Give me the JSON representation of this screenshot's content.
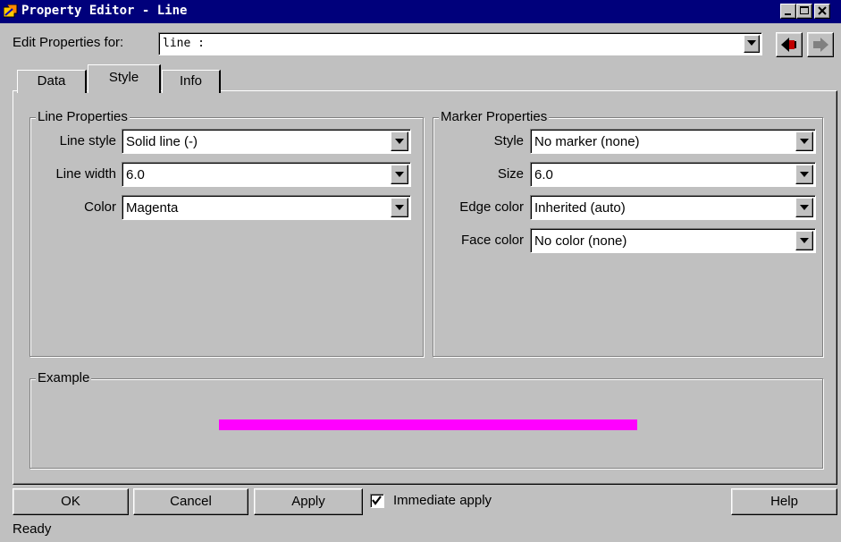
{
  "window": {
    "title": "Property Editor - Line",
    "controls": [
      "minimize-icon",
      "maximize-icon",
      "close-icon"
    ]
  },
  "edit_properties": {
    "label": "Edit Properties for:",
    "value": "line :",
    "nav_icons": [
      "back-arrow-icon",
      "forward-arrow-icon"
    ]
  },
  "tabs": [
    {
      "label": "Data",
      "selected": false
    },
    {
      "label": "Style",
      "selected": true
    },
    {
      "label": "Info",
      "selected": false
    }
  ],
  "line_properties": {
    "title": "Line Properties",
    "fields": [
      {
        "label": "Line style",
        "value": "Solid line (-)"
      },
      {
        "label": "Line width",
        "value": "6.0"
      },
      {
        "label": "Color",
        "value": "Magenta"
      }
    ]
  },
  "marker_properties": {
    "title": "Marker Properties",
    "fields": [
      {
        "label": "Style",
        "value": "No marker (none)"
      },
      {
        "label": "Size",
        "value": "6.0"
      },
      {
        "label": "Edge color",
        "value": "Inherited (auto)"
      },
      {
        "label": "Face color",
        "value": "No color (none)"
      }
    ]
  },
  "example": {
    "title": "Example",
    "line_color": "#ff00ff"
  },
  "buttons": {
    "ok": "OK",
    "cancel": "Cancel",
    "apply": "Apply",
    "help": "Help"
  },
  "immediate_apply": {
    "label": "Immediate apply",
    "checked": true
  },
  "status": "Ready",
  "colors": {
    "title_bar": "#00007b",
    "face": "#c0c0c0",
    "example_line": "#ff00ff"
  }
}
